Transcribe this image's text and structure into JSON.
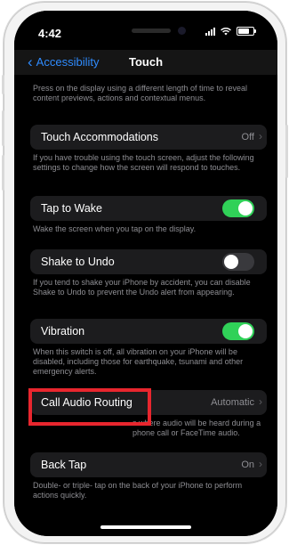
{
  "status": {
    "time": "4:42"
  },
  "nav": {
    "back_label": "Accessibility",
    "title": "Touch"
  },
  "intro_text": "Press on the display using a different length of time to reveal content previews, actions and contextual menus.",
  "rows": [
    {
      "label": "Touch Accommodations",
      "value": "Off",
      "kind": "chevron",
      "footer": "If you have trouble using the touch screen, adjust the following settings to change how the screen will respond to touches."
    },
    {
      "label": "Tap to Wake",
      "toggle": "on",
      "kind": "toggle",
      "footer": "Wake the screen when you tap on the display."
    },
    {
      "label": "Shake to Undo",
      "toggle": "off",
      "kind": "toggle",
      "footer": "If you tend to shake your iPhone by accident, you can disable Shake to Undo to prevent the Undo alert from appearing."
    },
    {
      "label": "Vibration",
      "toggle": "on",
      "kind": "toggle",
      "footer": "When this switch is off, all vibration on your iPhone will be disabled, including those for earthquake, tsunami and other emergency alerts."
    },
    {
      "label": "Call Audio Routing",
      "value": "Automatic",
      "kind": "chevron",
      "footer": "s where audio will be heard during a phone call or FaceTime audio."
    },
    {
      "label": "Back Tap",
      "value": "On",
      "kind": "chevron",
      "footer": "Double- or triple- tap on the back of your iPhone to perform actions quickly."
    }
  ],
  "colors": {
    "accent": "#2f8cff",
    "toggle_on": "#30d158",
    "highlight": "#e8262e",
    "row_bg": "#1c1c1e"
  },
  "icons": {
    "back": "chevron-left-icon",
    "row_chevron": "chevron-right-icon"
  }
}
